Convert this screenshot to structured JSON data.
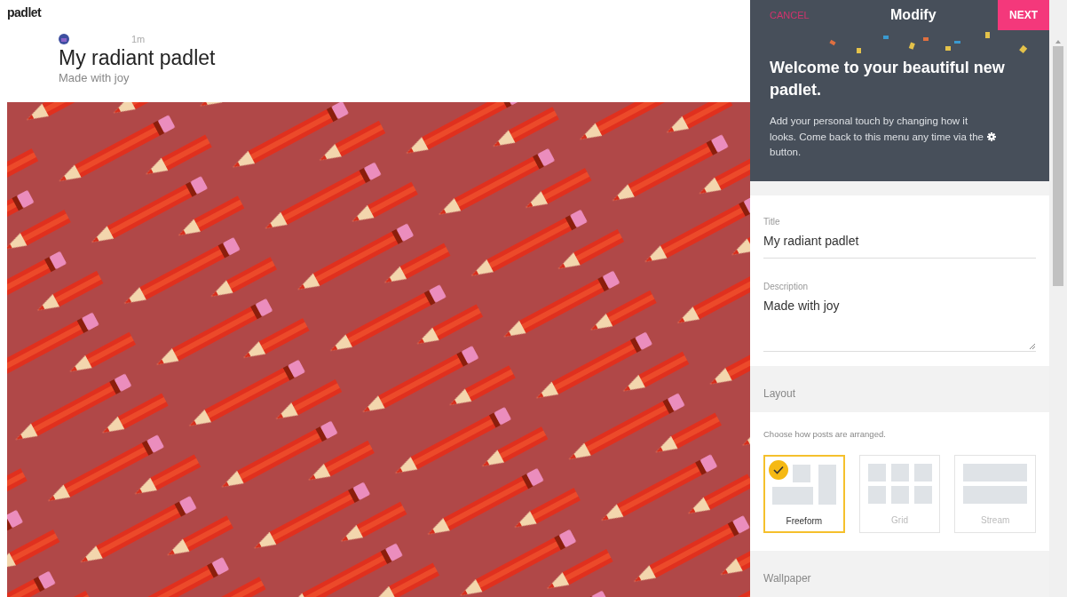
{
  "app": {
    "logo": "padlet"
  },
  "post": {
    "time": "1m",
    "title": "My radiant padlet",
    "description": "Made with joy"
  },
  "panel": {
    "cancel": "CANCEL",
    "title": "Modify",
    "next": "NEXT",
    "welcome_title": "Welcome to your beautiful new padlet.",
    "intro_lines": [
      "Add your personal touch by changing how it",
      "looks. Come back to this menu any time via the",
      "button."
    ],
    "fields": [
      {
        "label": "Title",
        "value": "My radiant padlet",
        "kind": "input"
      },
      {
        "label": "Description",
        "value": "Made with joy",
        "kind": "textarea"
      }
    ],
    "layout": {
      "heading": "Layout",
      "hint": "Choose how posts are arranged.",
      "options": [
        {
          "label": "Freeform",
          "kind": "freeform",
          "selected": true
        },
        {
          "label": "Grid",
          "kind": "grid",
          "selected": false
        },
        {
          "label": "Stream",
          "kind": "stream",
          "selected": false
        }
      ]
    },
    "wallpaper": {
      "heading": "Wallpaper"
    }
  }
}
